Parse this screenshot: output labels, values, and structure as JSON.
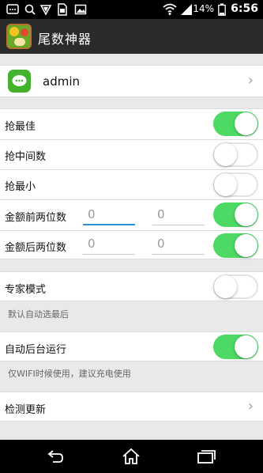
{
  "status": {
    "battery_percent": "14%",
    "time": "6:56"
  },
  "app": {
    "title": "尾数神器"
  },
  "account": {
    "username": "admin"
  },
  "settings": {
    "grab_best": "抢最佳",
    "grab_middle": "抢中间数",
    "grab_smallest": "抢最小",
    "amount_prefix": "金额前两位数",
    "amount_suffix": "金额后两位数",
    "prefix_value1": "0",
    "prefix_value2": "0",
    "suffix_value1": "0",
    "suffix_value2": "0"
  },
  "expert": {
    "label": "专家模式",
    "hint": "默认自动选最后"
  },
  "background": {
    "label": "自动后台运行",
    "hint": "仅WIFI时候使用，建议充电使用"
  },
  "update": {
    "label": "检测更新"
  },
  "toggles": {
    "grab_best": true,
    "grab_middle": false,
    "grab_smallest": false,
    "amount_prefix": true,
    "amount_suffix": true,
    "expert_mode": false,
    "auto_background": true
  },
  "colors": {
    "toggle_on": "#4cd964",
    "accent_focus": "#2b8fd6",
    "app_bar": "#2b2b2b"
  }
}
